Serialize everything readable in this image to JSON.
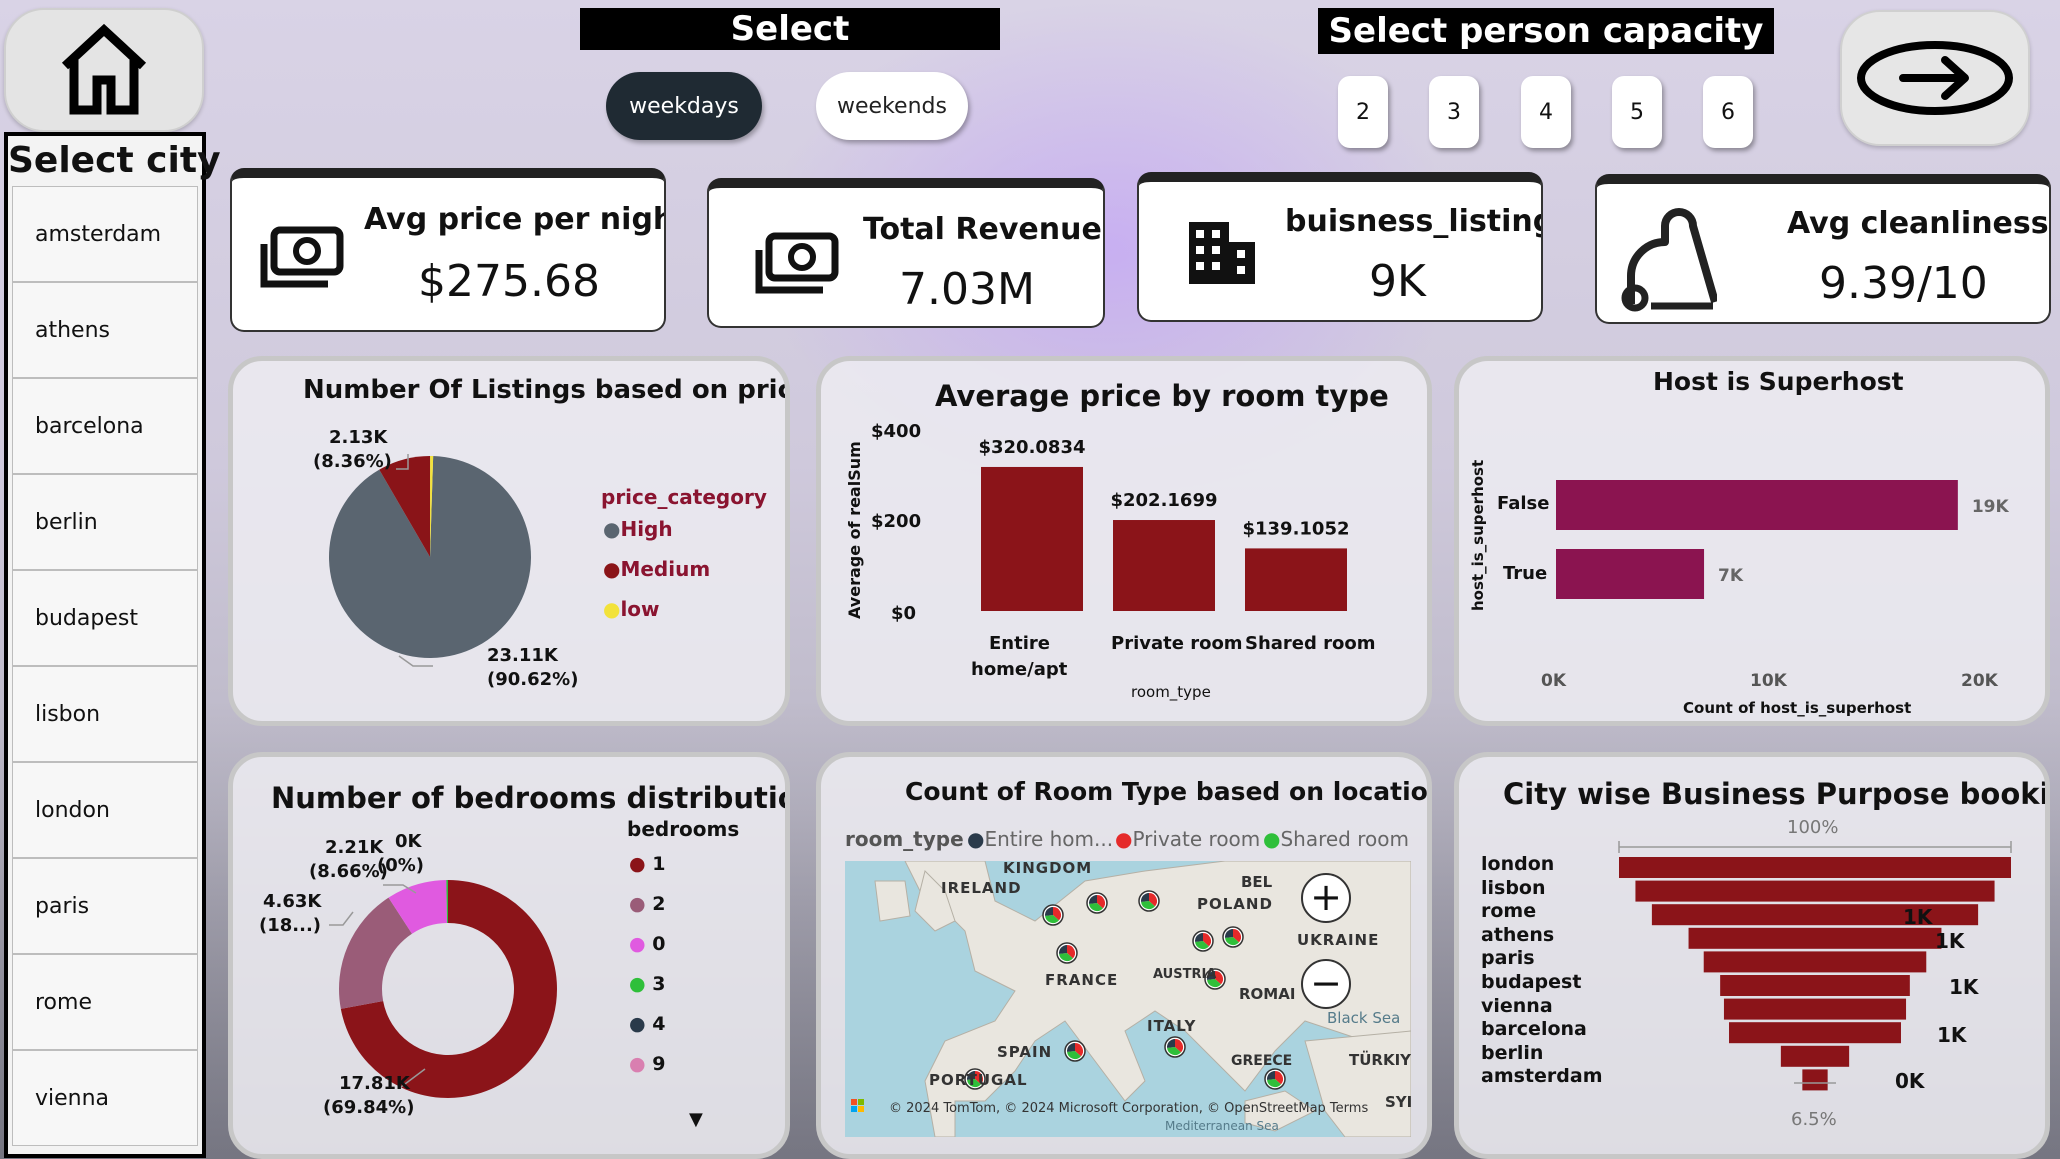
{
  "header": {
    "select_label": "Select",
    "day_options": [
      "weekdays",
      "weekends"
    ],
    "selected_day": "weekdays",
    "capacity_label": "Select person capacity",
    "capacity_options": [
      "2",
      "3",
      "4",
      "5",
      "6"
    ]
  },
  "sidebar": {
    "title": "Select city",
    "cities": [
      "amsterdam",
      "athens",
      "barcelona",
      "berlin",
      "budapest",
      "lisbon",
      "london",
      "paris",
      "rome",
      "vienna"
    ]
  },
  "kpis": [
    {
      "label": "Avg price per night",
      "value": "$275.68",
      "icon": "money-icon"
    },
    {
      "label": "Total Revenue",
      "value": "7.03M",
      "icon": "money-icon"
    },
    {
      "label": "buisness_listing",
      "value": "9K",
      "icon": "building-icon"
    },
    {
      "label": "Avg cleanliness...",
      "value": "9.39/10",
      "icon": "vacuum-icon"
    }
  ],
  "colors": {
    "high": "#5a6570",
    "medium": "#8a1418",
    "low": "#f2e23a",
    "bar_red": "#8b1419",
    "bar_magenta": "#8b1450",
    "pink": "#e05ae0",
    "mauve": "#9a5c78",
    "green": "#2fbf3a",
    "navy": "#2a3a4a",
    "light_pink": "#d97fb0"
  },
  "chart_data": [
    {
      "type": "pie",
      "title": "Number Of Listings based on prices",
      "legend_title": "price_category",
      "legend_placement": "right",
      "categories": [
        "High",
        "Medium",
        "low"
      ],
      "values": [
        23110,
        2130,
        120
      ],
      "data_labels": [
        "23.11K",
        "(90.62%)",
        "2.13K",
        "(8.36%)"
      ]
    },
    {
      "type": "bar",
      "title": "Average price by room type",
      "xlabel": "room_type",
      "ylabel": "Average of realSum",
      "categories": [
        "Entire home/apt",
        "Private room",
        "Shared room"
      ],
      "category_labels": [
        "Entire",
        "home/apt",
        "Private room",
        "Shared room"
      ],
      "values": [
        320.0834,
        202.1699,
        139.1052
      ],
      "data_labels": [
        "$320.0834",
        "$202.1699",
        "$139.1052"
      ],
      "ylim": [
        0,
        400
      ],
      "yticks": [
        "$400",
        "$200",
        "$0"
      ]
    },
    {
      "type": "bar",
      "orientation": "horizontal",
      "title": "Host is Superhost",
      "xlabel": "Count of host_is_superhost",
      "ylabel": "host_is_superhost",
      "categories": [
        "False",
        "True"
      ],
      "values": [
        19000,
        7000
      ],
      "data_labels": [
        "19K",
        "7K"
      ],
      "xlim": [
        0,
        20000
      ],
      "xticks": [
        "0K",
        "10K",
        "20K"
      ]
    },
    {
      "type": "pie",
      "subtype": "donut",
      "title": "Number of bedrooms distributions",
      "legend_title": "bedrooms",
      "legend_placement": "right",
      "categories": [
        "1",
        "2",
        "0",
        "3",
        "4",
        "9"
      ],
      "values": [
        17810,
        4630,
        2210,
        60,
        0,
        0
      ],
      "data_labels": [
        "17.81K",
        "(69.84%)",
        "4.63K",
        "(18...)",
        "2.21K",
        "(8.66%)",
        "0K",
        "(0%)"
      ]
    },
    {
      "type": "funnel",
      "title": "City wise Business Purpose booking",
      "categories": [
        "london",
        "lisbon",
        "rome",
        "athens",
        "paris",
        "budapest",
        "vienna",
        "barcelona",
        "berlin",
        "amsterdam"
      ],
      "values": [
        1550,
        1420,
        1290,
        1000,
        880,
        750,
        720,
        680,
        270,
        100
      ],
      "data_labels": [
        "1K",
        "1K",
        "1K",
        "1K",
        "0K"
      ],
      "top_percent": "100%",
      "bottom_percent": "6.5%"
    }
  ],
  "map": {
    "title": "Count of Room Type based on location",
    "legend_title": "room_type",
    "legend_items": [
      "Entire hom...",
      "Private room",
      "Shared room"
    ],
    "place_labels": [
      "KINGDOM",
      "IRELAND",
      "BEL",
      "POLAND",
      "UKRAINE",
      "FRANCE",
      "AUSTRIA",
      "ROMAI",
      "Black Sea",
      "ITALY",
      "SPAIN",
      "PORTUGAL",
      "GREECE",
      "TÜRKIY",
      "SYI",
      "Mediterranean Sea"
    ],
    "attribution": "© 2024 TomTom, © 2024 Microsoft Corporation, © OpenStreetMap  Terms",
    "zoom_in": "+",
    "zoom_out": "−"
  }
}
